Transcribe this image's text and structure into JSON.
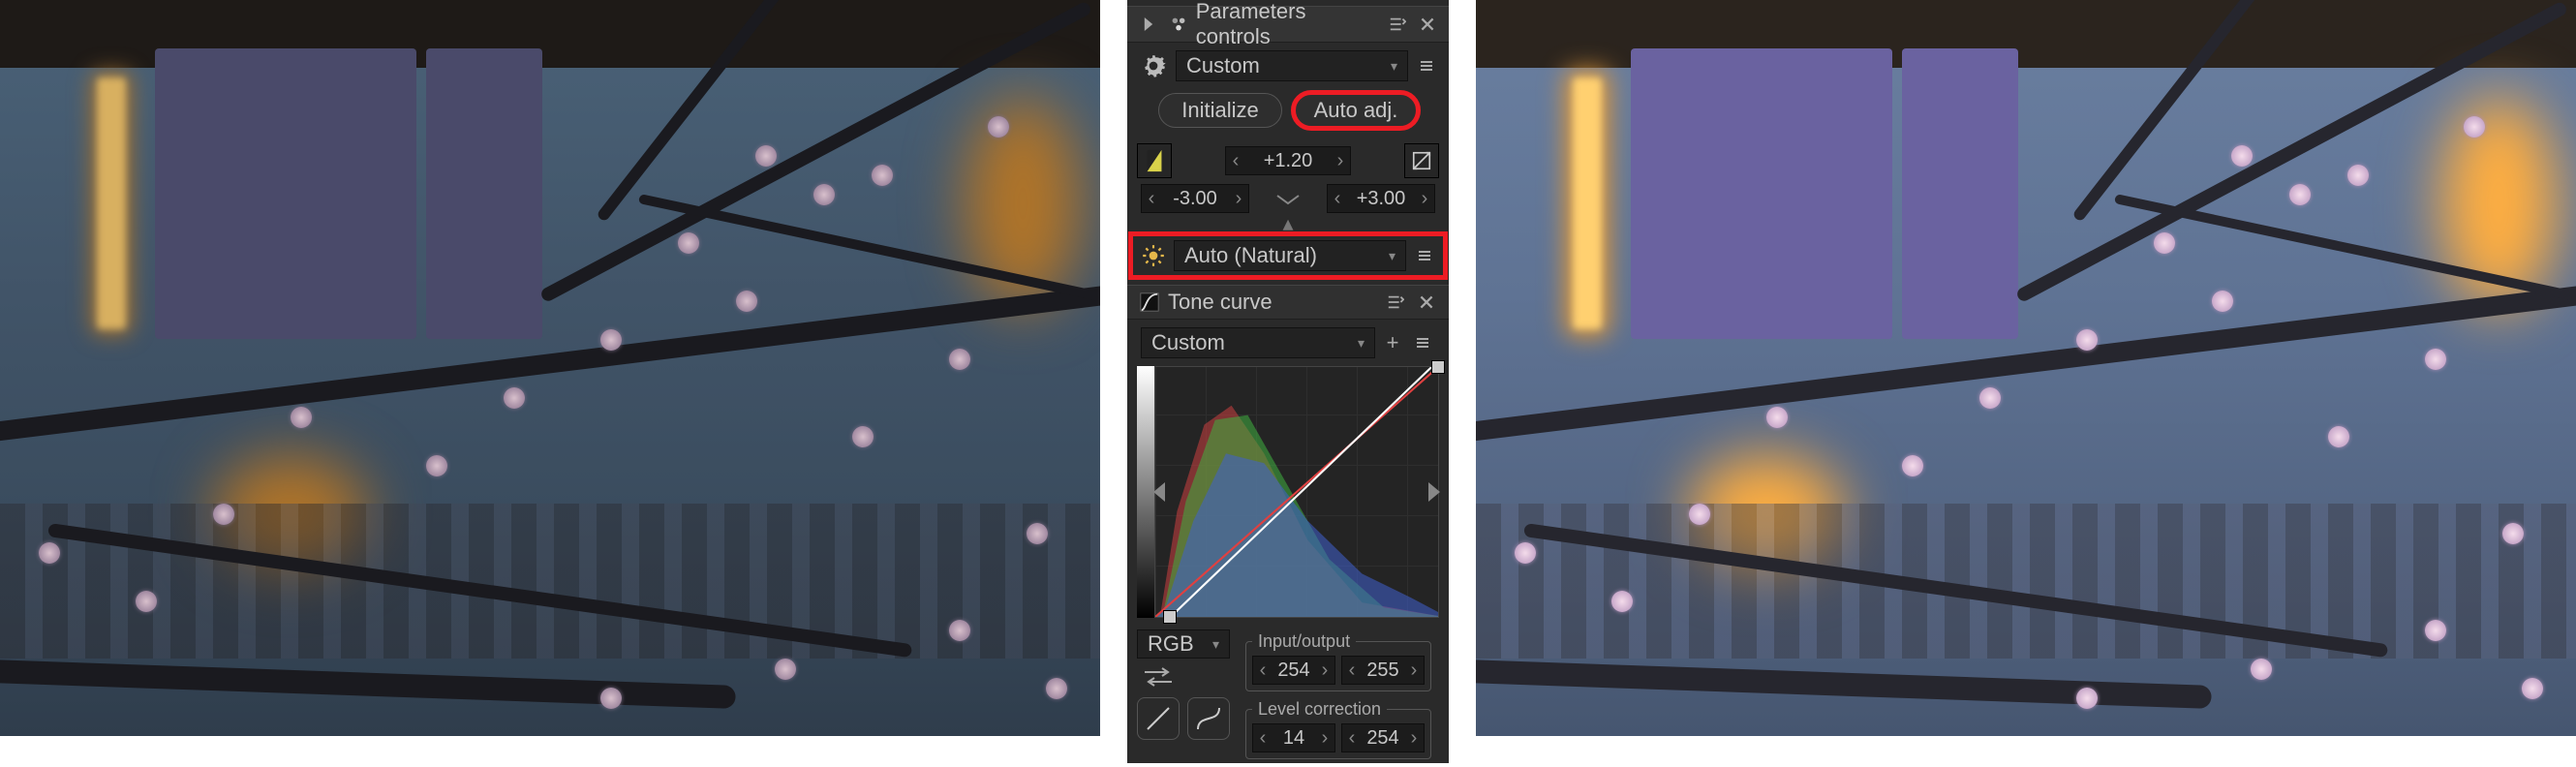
{
  "panel": {
    "title": "Parameters controls",
    "preset_label": "Custom",
    "buttons": {
      "initialize": "Initialize",
      "auto_adj": "Auto adj."
    },
    "exposure": {
      "value": "+1.20",
      "range_low": "-3.00",
      "range_high": "+3.00"
    },
    "wb": {
      "mode": "Auto (Natural)"
    },
    "tonecurve": {
      "title": "Tone curve",
      "preset": "Custom",
      "channel": "RGB",
      "io_label": "Input/output",
      "io_in": "254",
      "io_out": "255",
      "lvl_label": "Level correction",
      "lvl_lo": "14",
      "lvl_hi": "254"
    }
  }
}
